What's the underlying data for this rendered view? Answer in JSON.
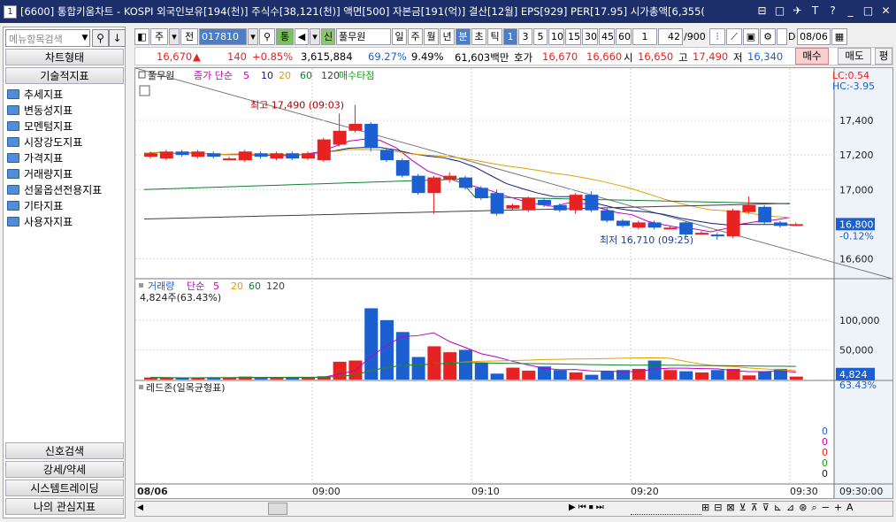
{
  "window": {
    "number": "1",
    "title": "[6600] 통합키움차트 - KOSPI 외국인보유[194(천)] 주식수[38,121(천)] 액면[500] 자본금[191(억)] 결산[12월] EPS[929] PER[17.95] 시가총액[6,355("
  },
  "sidebar": {
    "search_placeholder": "메뉴항목검색",
    "chart_type_label": "차트형태",
    "tech_label": "기술적지표",
    "items": [
      "추세지표",
      "변동성지표",
      "모멘텀지표",
      "시장강도지표",
      "가격지표",
      "거래량지표",
      "선물옵션전용지표",
      "기타지표",
      "사용자지표"
    ],
    "bottom": [
      "신호검색",
      "강세/약세",
      "시스템트레이딩",
      "나의 관심지표"
    ]
  },
  "toolbar": {
    "period_type": "주",
    "all_label": "전",
    "code": "017810",
    "tong": "통",
    "credit_label": "신",
    "stock_name": "풀무원",
    "periods": [
      "일",
      "주",
      "월",
      "년",
      "분",
      "초",
      "틱"
    ],
    "active_period": "분",
    "intervals": [
      "1",
      "3",
      "5",
      "10",
      "15",
      "30",
      "45",
      "60"
    ],
    "active_interval": "1",
    "interval_select": "1",
    "count": "42",
    "count_total": "/900",
    "date": "08/06",
    "d_label": "D"
  },
  "quote": {
    "price": "16,670",
    "change": "140",
    "change_pct": "+0.85%",
    "volume": "3,615,884",
    "vol_ratio": "69.27%",
    "turnover": "9.49%",
    "amount": "61,603백만",
    "bid_label": "호가",
    "ask": "16,670",
    "bid": "16,660",
    "open_label": "시",
    "open": "16,650",
    "high_label": "고",
    "high": "17,490",
    "low_label": "저",
    "low": "16,340",
    "buy_btn": "매수",
    "sell_btn": "매도",
    "eval_btn": "평"
  },
  "price_pane": {
    "legend_name": "풀무원",
    "legend_ma": "종가 단순",
    "ma_periods": [
      "5",
      "10",
      "20",
      "60",
      "120"
    ],
    "legend_signal": "매수타점",
    "lc": "LC:0.54",
    "hc": "HC:-3.95",
    "current": "16,800",
    "current_pct": "-0.12%",
    "high_note": "최고 17,490 (09:03)",
    "low_note": "최저 16,710 (09:25)",
    "y_ticks": [
      "17,400",
      "17,200",
      "17,000",
      "16,600"
    ]
  },
  "volume_pane": {
    "legend_name": "거래량",
    "legend_ma": "단순",
    "ma_periods": [
      "5",
      "20",
      "60",
      "120"
    ],
    "vol_text": "4,824주(63.43%)",
    "current": "4,824",
    "current_pct": "63.43%",
    "y_ticks": [
      "100,000",
      "50,000"
    ]
  },
  "red_pane": {
    "legend": "레드존(일목균형표)",
    "values": [
      "0",
      "0",
      "0",
      "0",
      "0"
    ]
  },
  "x_axis": {
    "date": "08/06",
    "ticks": [
      "09:00",
      "09:10",
      "09:20",
      "09:30"
    ],
    "right_time": "09:30:00"
  },
  "chart_data": {
    "type": "candlestick",
    "candles": [
      {
        "o": 17190,
        "c": 17210,
        "h": 17220,
        "l": 17180
      },
      {
        "o": 17180,
        "c": 17220,
        "h": 17230,
        "l": 17170
      },
      {
        "o": 17220,
        "c": 17200,
        "h": 17230,
        "l": 17190
      },
      {
        "o": 17190,
        "c": 17220,
        "h": 17230,
        "l": 17180
      },
      {
        "o": 17210,
        "c": 17190,
        "h": 17220,
        "l": 17180
      },
      {
        "o": 17180,
        "c": 17180,
        "h": 17190,
        "l": 17170
      },
      {
        "o": 17170,
        "c": 17220,
        "h": 17230,
        "l": 17160
      },
      {
        "o": 17210,
        "c": 17190,
        "h": 17220,
        "l": 17180
      },
      {
        "o": 17180,
        "c": 17210,
        "h": 17220,
        "l": 17170
      },
      {
        "o": 17210,
        "c": 17180,
        "h": 17220,
        "l": 17170
      },
      {
        "o": 17180,
        "c": 17210,
        "h": 17220,
        "l": 17170
      },
      {
        "o": 17170,
        "c": 17290,
        "h": 17300,
        "l": 17160
      },
      {
        "o": 17260,
        "c": 17340,
        "h": 17440,
        "l": 17250
      },
      {
        "o": 17340,
        "c": 17380,
        "h": 17490,
        "l": 17330
      },
      {
        "o": 17380,
        "c": 17240,
        "h": 17390,
        "l": 17220
      },
      {
        "o": 17230,
        "c": 17170,
        "h": 17240,
        "l": 17160
      },
      {
        "o": 17170,
        "c": 17080,
        "h": 17180,
        "l": 17070
      },
      {
        "o": 17080,
        "c": 16980,
        "h": 17090,
        "l": 16970
      },
      {
        "o": 16980,
        "c": 17070,
        "h": 17080,
        "l": 16860
      },
      {
        "o": 17060,
        "c": 17080,
        "h": 17100,
        "l": 17040
      },
      {
        "o": 17070,
        "c": 17010,
        "h": 17080,
        "l": 17000
      },
      {
        "o": 17010,
        "c": 16950,
        "h": 17020,
        "l": 16940
      },
      {
        "o": 16980,
        "c": 16860,
        "h": 17000,
        "l": 16850
      },
      {
        "o": 16890,
        "c": 16910,
        "h": 16920,
        "l": 16880
      },
      {
        "o": 16880,
        "c": 16950,
        "h": 16960,
        "l": 16870
      },
      {
        "o": 16940,
        "c": 16910,
        "h": 16950,
        "l": 16900
      },
      {
        "o": 16910,
        "c": 16880,
        "h": 16920,
        "l": 16870
      },
      {
        "o": 16880,
        "c": 16970,
        "h": 16980,
        "l": 16860
      },
      {
        "o": 16970,
        "c": 16880,
        "h": 16990,
        "l": 16870
      },
      {
        "o": 16880,
        "c": 16820,
        "h": 16890,
        "l": 16810
      },
      {
        "o": 16820,
        "c": 16790,
        "h": 16830,
        "l": 16780
      },
      {
        "o": 16780,
        "c": 16810,
        "h": 16820,
        "l": 16770
      },
      {
        "o": 16810,
        "c": 16780,
        "h": 16820,
        "l": 16770
      },
      {
        "o": 16780,
        "c": 16780,
        "h": 16790,
        "l": 16770
      },
      {
        "o": 16810,
        "c": 16740,
        "h": 16820,
        "l": 16730
      },
      {
        "o": 16750,
        "c": 16750,
        "h": 16760,
        "l": 16740
      },
      {
        "o": 16740,
        "c": 16730,
        "h": 16750,
        "l": 16710
      },
      {
        "o": 16730,
        "c": 16880,
        "h": 16890,
        "l": 16720
      },
      {
        "o": 16870,
        "c": 16910,
        "h": 16960,
        "l": 16860
      },
      {
        "o": 16900,
        "c": 16810,
        "h": 16910,
        "l": 16800
      },
      {
        "o": 16810,
        "c": 16790,
        "h": 16820,
        "l": 16780
      },
      {
        "o": 16800,
        "c": 16800,
        "h": 16810,
        "l": 16790
      }
    ],
    "volumes": [
      3500,
      3000,
      2500,
      3000,
      3500,
      3000,
      5000,
      4000,
      3200,
      4000,
      3500,
      5500,
      30000,
      32000,
      120000,
      100000,
      80000,
      38000,
      56000,
      46000,
      50000,
      28000,
      10000,
      20000,
      15000,
      22000,
      16000,
      12000,
      8000,
      14000,
      16000,
      18000,
      32000,
      16000,
      14000,
      12000,
      16000,
      18000,
      7000,
      14000,
      18000,
      5000
    ],
    "y_range": [
      16500,
      17600
    ],
    "vol_range": [
      0,
      140000
    ]
  },
  "colors": {
    "up": "#e62222",
    "down": "#1c5fd0",
    "ma5": "#c000c0",
    "ma10": "#102080",
    "ma20": "#e0a000",
    "ma60": "#108030",
    "ma120": "#404040"
  }
}
